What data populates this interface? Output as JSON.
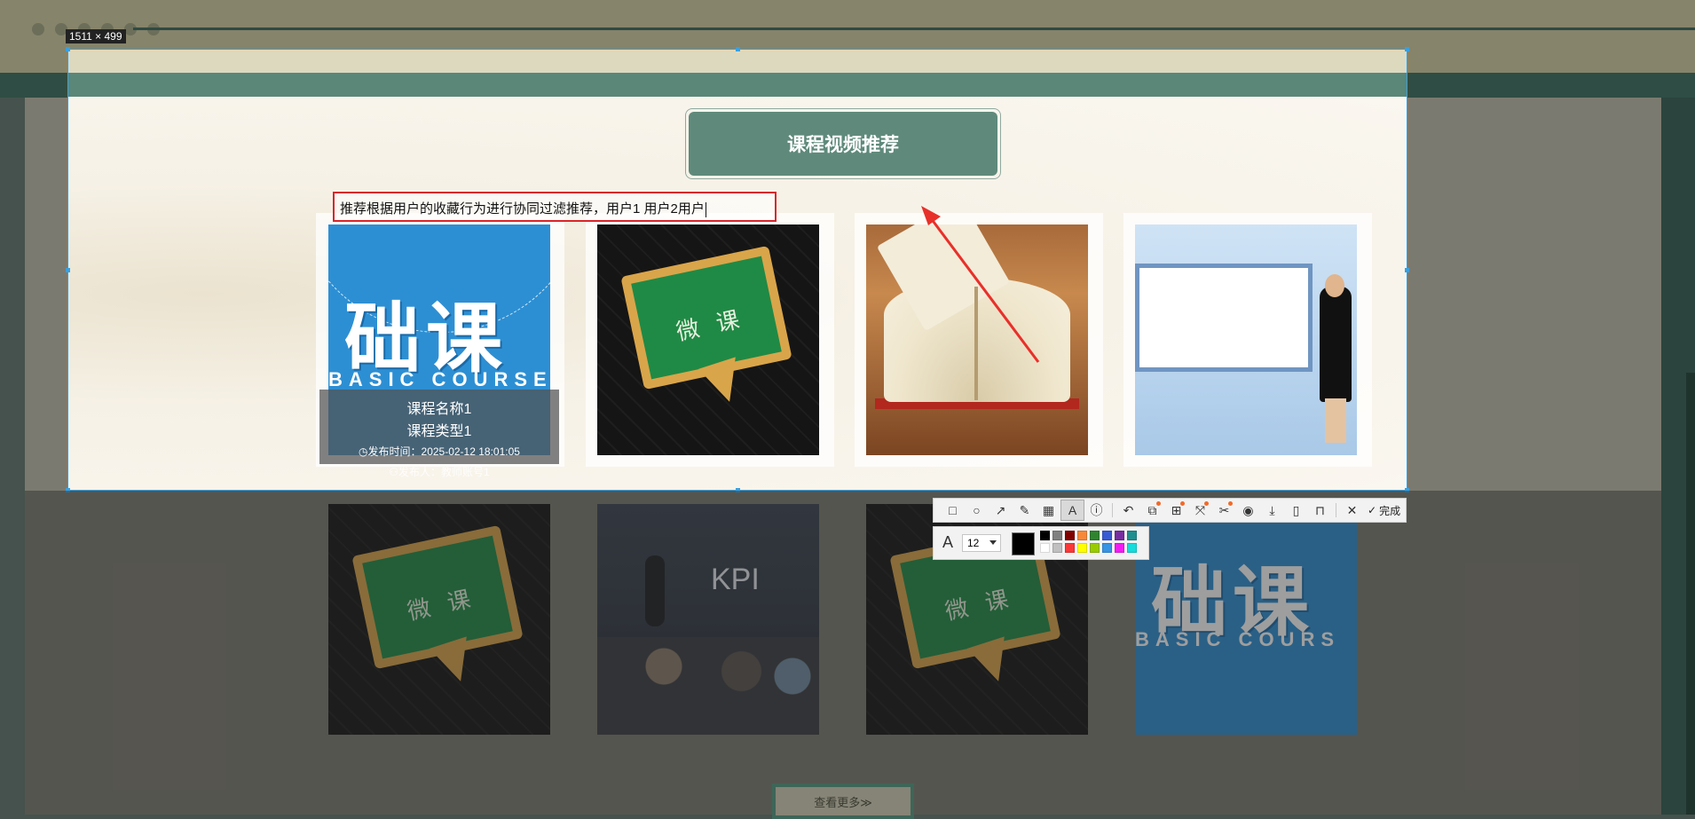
{
  "selection": {
    "size_label": "1511 × 499"
  },
  "section_title": "课程视频推荐",
  "annotation": {
    "text": "推荐根据用户的收藏行为进行协同过滤推荐，用户1 用户2用户"
  },
  "courses_row1": [
    {
      "image": "basic-course",
      "big_text": "础课",
      "small_text": "BASIC COURSE"
    },
    {
      "image": "chalkboard-weike",
      "board_text": "微课"
    },
    {
      "image": "open-book"
    },
    {
      "image": "teacher-presenter"
    }
  ],
  "hover_card": {
    "name": "课程名称1",
    "type": "课程类型1",
    "time": "发布时间：2025-02-12 18:01:05",
    "publisher": "发布人：教师账号1"
  },
  "courses_row2": [
    {
      "image": "chalkboard-weike",
      "board_text": "微课"
    },
    {
      "image": "kpi-classroom",
      "kpi_text": "KPI"
    },
    {
      "image": "chalkboard-weike",
      "board_text": "微课"
    },
    {
      "image": "basic-course",
      "big_text": "础课",
      "small_text": "BASIC COURS"
    }
  ],
  "toolbar": {
    "tools": [
      "rectangle",
      "ellipse",
      "arrow",
      "pen",
      "mosaic",
      "text",
      "serial-number"
    ],
    "actions": [
      "undo",
      "pin",
      "ocr",
      "scroll-capture",
      "translate",
      "record",
      "save",
      "save-pdf",
      "bookmark",
      "cancel"
    ],
    "done_label": "完成"
  },
  "text_settings": {
    "font_size": "12",
    "current_color": "#000000",
    "palette": [
      "#000000",
      "#808080",
      "#800000",
      "#f7883a",
      "#308430",
      "#385ad3",
      "#772d9f",
      "#1f8f8f",
      "#ffffff",
      "#c0c0c0",
      "#fb3838",
      "#ffff00",
      "#99cc00",
      "#3894e4",
      "#f31bf3",
      "#16dcdc"
    ]
  },
  "more_button": "查看更多≫",
  "accent_colors": {
    "selection": "#3aa0e0",
    "annotation": "#d9252a",
    "title_bg": "#5f8a7b"
  }
}
